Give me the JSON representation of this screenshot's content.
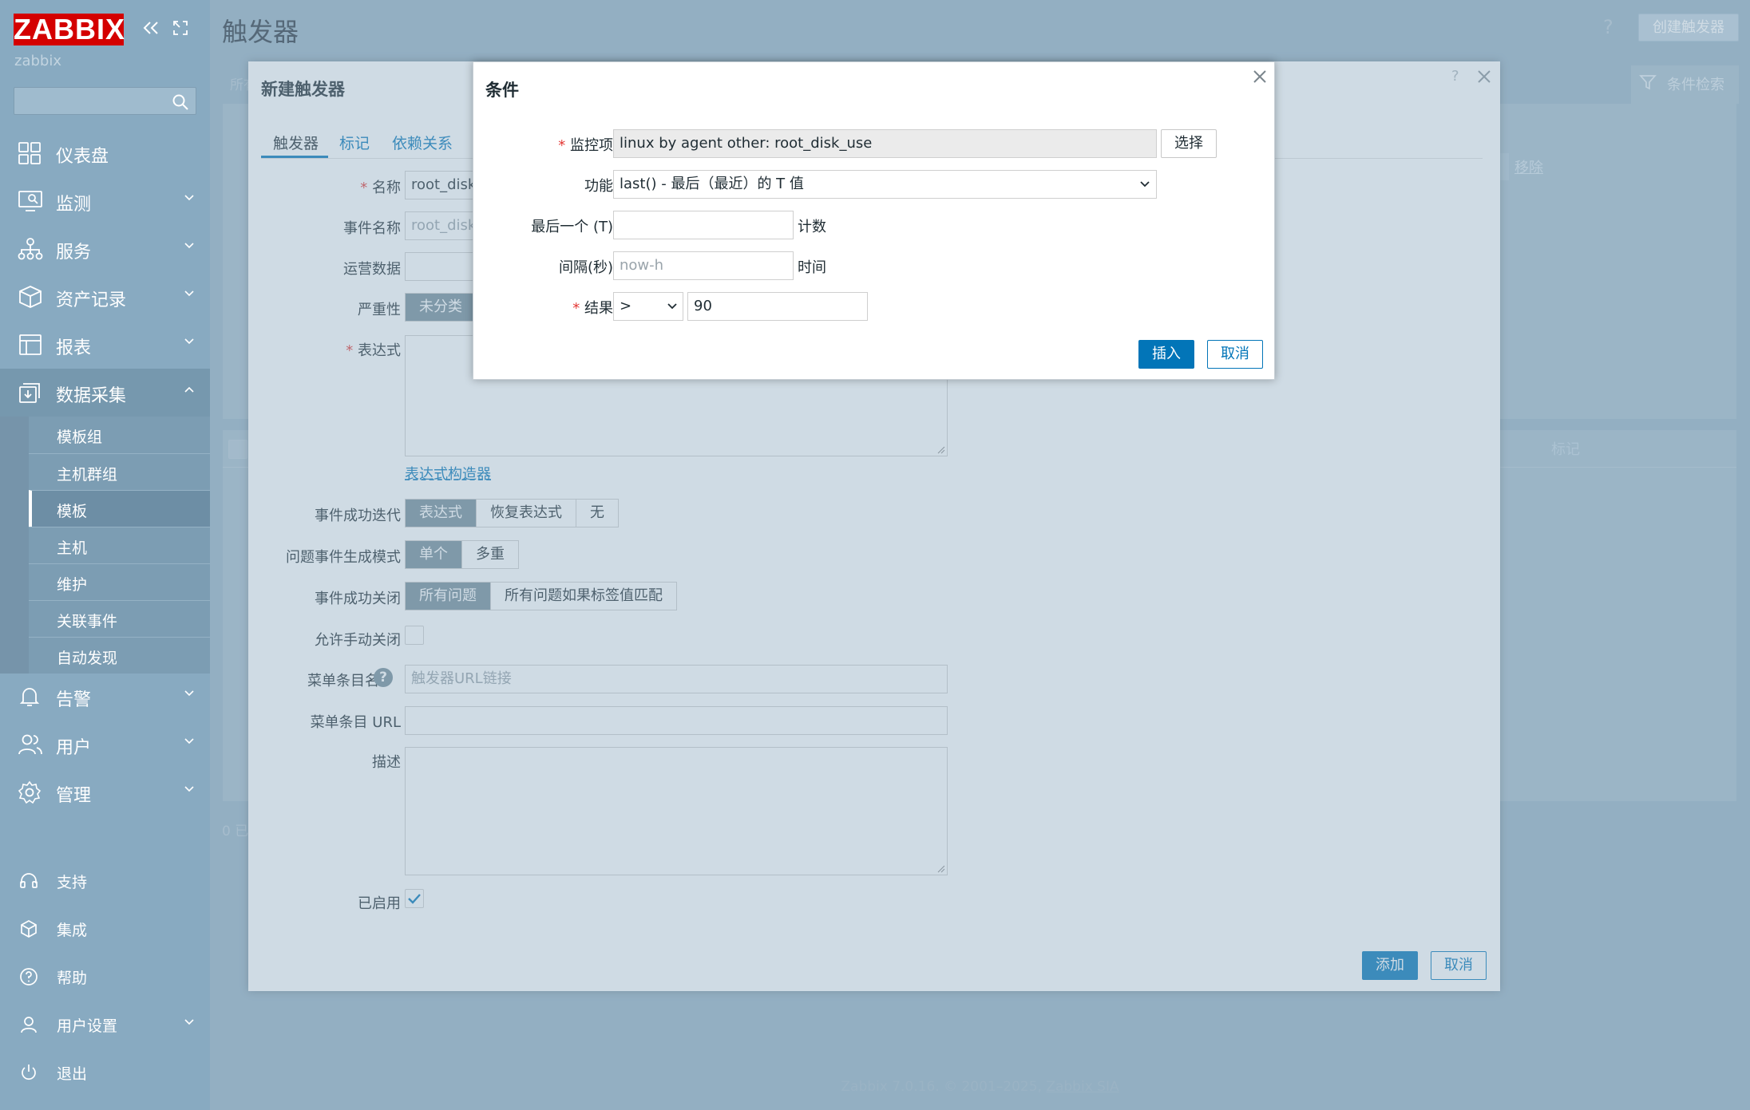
{
  "app": {
    "logo": "ZABBIX",
    "server": "zabbix"
  },
  "sidebar": {
    "menu": [
      {
        "label": "仪表盘",
        "icon": "dashboard-icon"
      },
      {
        "label": "监测",
        "icon": "monitoring-icon"
      },
      {
        "label": "服务",
        "icon": "services-icon"
      },
      {
        "label": "资产记录",
        "icon": "inventory-icon"
      },
      {
        "label": "报表",
        "icon": "reports-icon"
      },
      {
        "label": "数据采集",
        "icon": "data-collection-icon"
      }
    ],
    "submenu": [
      "模板组",
      "主机群组",
      "模板",
      "主机",
      "维护",
      "关联事件",
      "自动发现"
    ],
    "menu2": [
      {
        "label": "告警",
        "icon": "alerts-icon"
      },
      {
        "label": "用户",
        "icon": "users-icon"
      },
      {
        "label": "管理",
        "icon": "administration-icon"
      }
    ],
    "bottom": [
      {
        "label": "支持",
        "icon": "headset-icon"
      },
      {
        "label": "集成",
        "icon": "integrations-icon"
      },
      {
        "label": "帮助",
        "icon": "help-icon"
      },
      {
        "label": "用户设置",
        "icon": "user-icon"
      },
      {
        "label": "退出",
        "icon": "power-icon"
      }
    ]
  },
  "page": {
    "title": "触发器",
    "create_btn": "创建触发器",
    "filter": "条件检索",
    "remove": "移除",
    "tags_col": "标记",
    "breadcrumb": "所有",
    "count": "0 已"
  },
  "trigger_dialog": {
    "title": "新建触发器",
    "tabs": [
      "触发器",
      "标记",
      "依赖关系"
    ],
    "labels": {
      "name": "名称",
      "event_name": "事件名称",
      "opdata": "运营数据",
      "severity": "严重性",
      "expression": "表达式",
      "ok_event": "事件成功迭代",
      "gen_mode": "问题事件生成模式",
      "ok_close": "事件成功关闭",
      "manual_close": "允许手动关闭",
      "url_name": "菜单条目名",
      "url": "菜单条目 URL",
      "description": "描述",
      "enabled": "已启用"
    },
    "values": {
      "name": "root_disk_",
      "event_name_placeholder": "root_disk_",
      "url_name_placeholder": "触发器URL链接"
    },
    "severity": [
      "未分类"
    ],
    "expression_builder": "表达式构造器",
    "ok_event_opts": [
      "表达式",
      "恢复表达式",
      "无"
    ],
    "gen_mode_opts": [
      "单个",
      "多重"
    ],
    "ok_close_opts": [
      "所有问题",
      "所有问题如果标签值匹配"
    ],
    "add_btn": "添加",
    "cancel_btn": "取消"
  },
  "condition_dialog": {
    "title": "条件",
    "labels": {
      "item": "监控项",
      "function": "功能",
      "last": "最后一个 (T)",
      "shift": "间隔(秒)",
      "result": "结果"
    },
    "item_value": "linux by agent other: root_disk_use",
    "select_btn": "选择",
    "function_value": "last() - 最后（最近）的 T 值",
    "last_unit": "计数",
    "shift_placeholder": "now-h",
    "shift_unit": "时间",
    "operator": ">",
    "result_value": "90",
    "insert_btn": "插入",
    "cancel_btn": "取消"
  },
  "footer": {
    "text": "Zabbix 7.0.16. © 2001–2025,",
    "link": "Zabbix SIA"
  }
}
